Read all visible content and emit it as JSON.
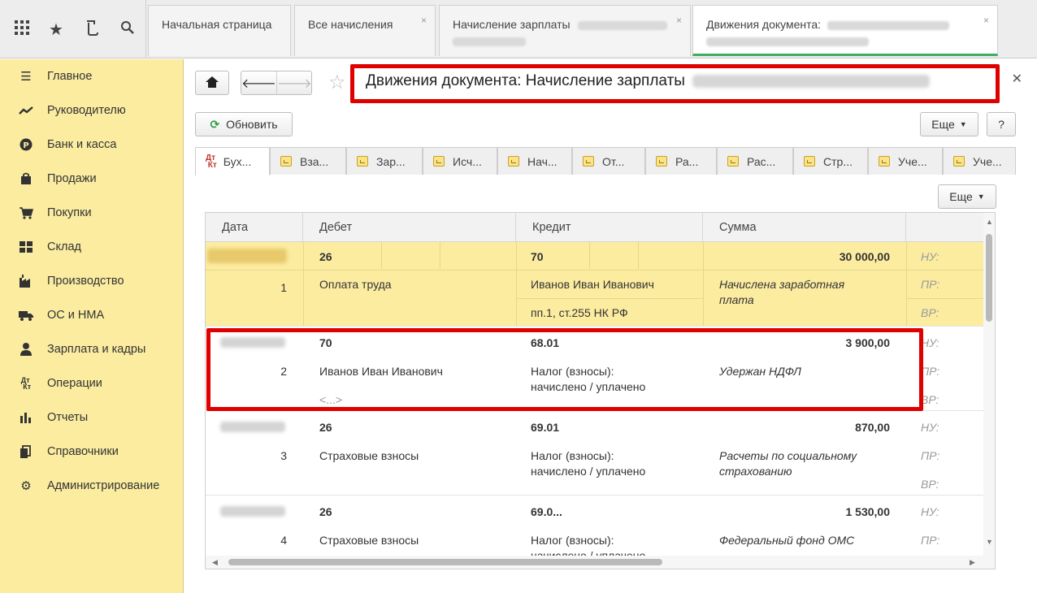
{
  "top_tabs": [
    {
      "label": "Начальная страница"
    },
    {
      "label": "Все начисления",
      "close": "×"
    },
    {
      "label": "Начисление зарплаты",
      "close": "×"
    },
    {
      "label": "Движения документа:",
      "close": "×"
    }
  ],
  "sidebar": {
    "items": [
      {
        "label": "Главное",
        "icon": "menu-icon"
      },
      {
        "label": "Руководителю",
        "icon": "trend-icon"
      },
      {
        "label": "Банк и касса",
        "icon": "ruble-icon"
      },
      {
        "label": "Продажи",
        "icon": "bag-icon"
      },
      {
        "label": "Покупки",
        "icon": "cart-icon"
      },
      {
        "label": "Склад",
        "icon": "warehouse-icon"
      },
      {
        "label": "Производство",
        "icon": "factory-icon"
      },
      {
        "label": "ОС и НМА",
        "icon": "truck-icon"
      },
      {
        "label": "Зарплата и кадры",
        "icon": "person-icon"
      },
      {
        "label": "Операции",
        "icon": "dt-kt-icon"
      },
      {
        "label": "Отчеты",
        "icon": "bar-chart-icon"
      },
      {
        "label": "Справочники",
        "icon": "books-icon"
      },
      {
        "label": "Администрирование",
        "icon": "gear-icon"
      }
    ]
  },
  "header": {
    "title": "Движения документа: Начисление зарплаты",
    "refresh_label": "Обновить",
    "more_label": "Еще",
    "help_label": "?"
  },
  "inner_tabs": [
    "Бух...",
    "Вза...",
    "Зар...",
    "Исч...",
    "Нач...",
    "От...",
    "Ра...",
    "Рас...",
    "Стр...",
    "Уче...",
    "Уче..."
  ],
  "table": {
    "more_label": "Еще",
    "columns": [
      "Дата",
      "Дебет",
      "Кредит",
      "Сумма"
    ],
    "rows": [
      {
        "num": "1",
        "debit": "26",
        "debit_sub": "Оплата труда",
        "debit_extra": "",
        "credit": "70",
        "credit_sub1": "Иванов Иван Иванович",
        "credit_sub2": "пп.1, ст.255 НК РФ",
        "amount": "30 000,00",
        "desc1": "Начислена заработная",
        "desc2": "плата"
      },
      {
        "num": "2",
        "debit": "70",
        "debit_sub": "Иванов Иван Иванович",
        "debit_extra": "<...>",
        "credit": "68.01",
        "credit_sub1": "Налог (взносы):",
        "credit_sub2": "начислено / уплачено",
        "amount": "3 900,00",
        "desc1": "Удержан НДФЛ",
        "desc2": ""
      },
      {
        "num": "3",
        "debit": "26",
        "debit_sub": "Страховые взносы",
        "debit_extra": "",
        "credit": "69.01",
        "credit_sub1": "Налог (взносы):",
        "credit_sub2": "начислено / уплачено",
        "amount": "870,00",
        "desc1": "Расчеты по социальному",
        "desc2": "страхованию"
      },
      {
        "num": "4",
        "debit": "26",
        "debit_sub": "Страховые взносы",
        "debit_extra": "",
        "credit": "69.0...",
        "credit_sub1": "Налог (взносы):",
        "credit_sub2": "начислено / уплачено",
        "amount": "1 530,00",
        "desc1": "Федеральный фонд ОМС",
        "desc2": ""
      }
    ],
    "tax_labels": [
      "НУ:",
      "ПР:",
      "ВР:"
    ]
  },
  "colors": {
    "sidebar": "#fbeca0",
    "selection": "#fbeca0",
    "highlight": "#e00000",
    "active_tab": "#3fae5a"
  }
}
